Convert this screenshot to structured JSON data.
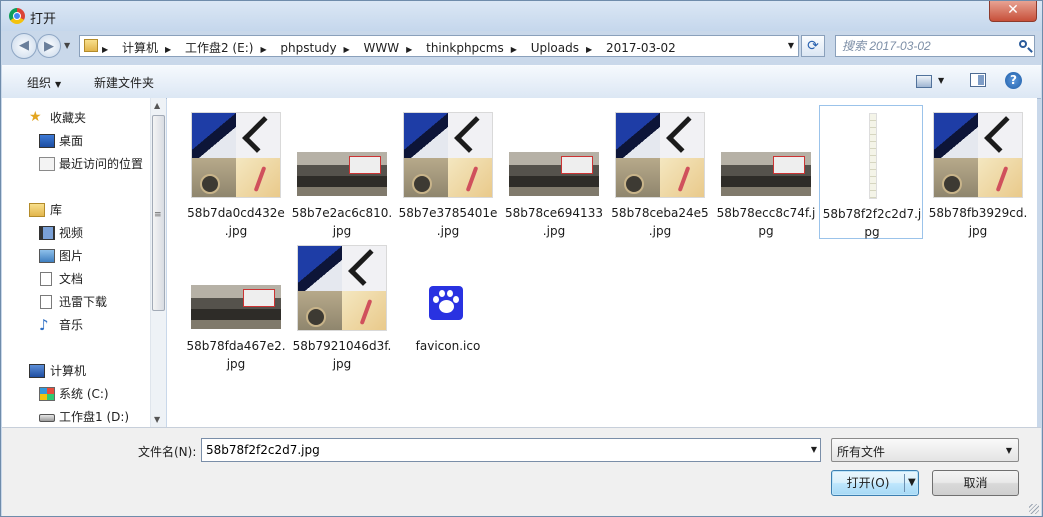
{
  "window": {
    "title": "打开",
    "close_symbol": "✕"
  },
  "nav": {
    "back_symbol": "◀",
    "forward_symbol": "▶",
    "breadcrumb": [
      "计算机",
      "工作盘2 (E:)",
      "phpstudy",
      "WWW",
      "thinkphpcms",
      "Uploads",
      "2017-03-02"
    ],
    "search_placeholder": "搜索 2017-03-02"
  },
  "toolbar": {
    "organize_label": "组织",
    "new_folder_label": "新建文件夹",
    "help_symbol": "?"
  },
  "sidebar": {
    "items": [
      {
        "label": "收藏夹",
        "icon": "star-icon",
        "level": 0
      },
      {
        "label": "桌面",
        "icon": "desktop-icon",
        "level": 1
      },
      {
        "label": "最近访问的位置",
        "icon": "recent-places-icon",
        "level": 1
      },
      {
        "label": "库",
        "icon": "library-icon",
        "level": 0
      },
      {
        "label": "视频",
        "icon": "video-icon",
        "level": 1
      },
      {
        "label": "图片",
        "icon": "picture-icon",
        "level": 1
      },
      {
        "label": "文档",
        "icon": "document-icon",
        "level": 1
      },
      {
        "label": "迅雷下载",
        "icon": "download-icon",
        "level": 1
      },
      {
        "label": "音乐",
        "icon": "music-icon",
        "level": 1
      },
      {
        "label": "计算机",
        "icon": "computer-icon",
        "level": 0
      },
      {
        "label": "系统 (C:)",
        "icon": "system-drive-icon",
        "level": 1
      },
      {
        "label": "工作盘1 (D:)",
        "icon": "drive-icon",
        "level": 1
      }
    ]
  },
  "files": [
    {
      "name_line1": "58b7da0cd432e",
      "name_line2": ".jpg",
      "thumb": "collage"
    },
    {
      "name_line1": "58b7e2ac6c810.",
      "name_line2": "jpg",
      "thumb": "group-photo"
    },
    {
      "name_line1": "58b7e3785401e",
      "name_line2": ".jpg",
      "thumb": "collage"
    },
    {
      "name_line1": "58b78ce694133",
      "name_line2": ".jpg",
      "thumb": "group-photo"
    },
    {
      "name_line1": "58b78ceba24e5",
      "name_line2": ".jpg",
      "thumb": "collage"
    },
    {
      "name_line1": "58b78ecc8c74f.j",
      "name_line2": "pg",
      "thumb": "group-photo"
    },
    {
      "name_line1": "58b78f2f2c2d7.j",
      "name_line2": "pg",
      "thumb": "strip",
      "selected": true
    },
    {
      "name_line1": "58b78fb3929cd.",
      "name_line2": "jpg",
      "thumb": "collage"
    },
    {
      "name_line1": "58b78fda467e2.",
      "name_line2": "jpg",
      "thumb": "group-photo"
    },
    {
      "name_line1": "58b7921046d3f.",
      "name_line2": "jpg",
      "thumb": "collage"
    },
    {
      "name_line1": "favicon.ico",
      "name_line2": "",
      "thumb": "paw-icon"
    }
  ],
  "footer": {
    "filename_label": "文件名(N):",
    "filename_value": "58b78f2f2c2d7.jpg",
    "filetype_value": "所有文件",
    "open_label": "打开(O)",
    "cancel_label": "取消"
  },
  "colors": {
    "accent": "#3c7fb1",
    "paw_icon_bg": "#2932e1",
    "selection_border": "#9bc3ea"
  }
}
